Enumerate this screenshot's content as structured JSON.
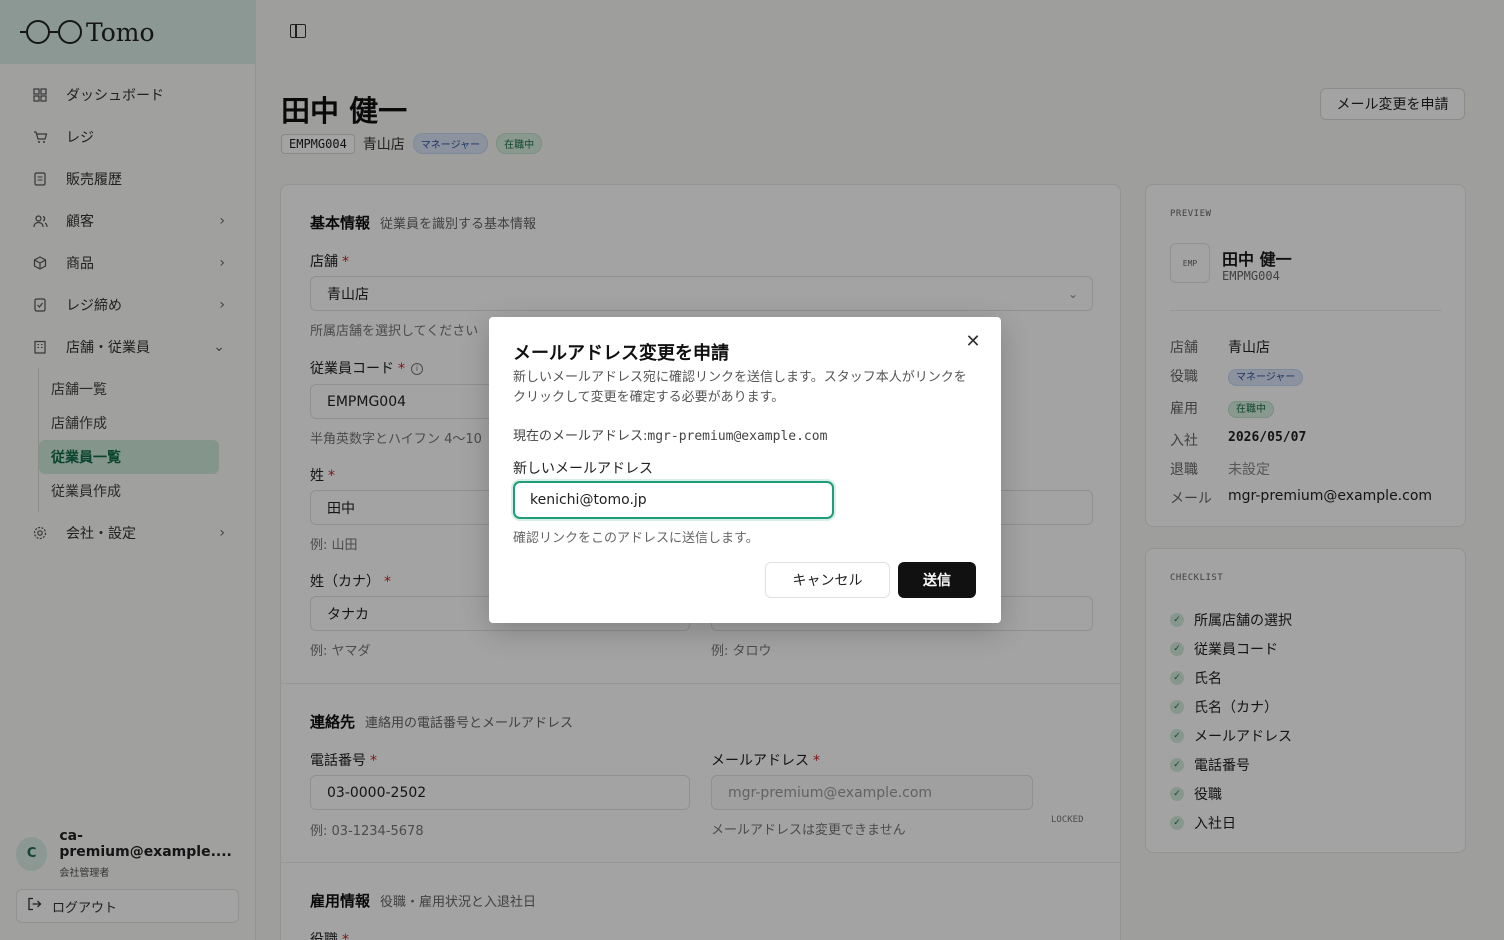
{
  "app": {
    "logo_text": "Tomo"
  },
  "sidebar": {
    "items": [
      {
        "label": "ダッシュボード",
        "icon": "grid-icon"
      },
      {
        "label": "レジ",
        "icon": "cart-icon"
      },
      {
        "label": "販売履歴",
        "icon": "receipt-icon"
      },
      {
        "label": "顧客",
        "icon": "users-icon"
      },
      {
        "label": "商品",
        "icon": "box-icon"
      },
      {
        "label": "レジ締め",
        "icon": "register-icon"
      },
      {
        "label": "店舗・従業員",
        "icon": "building-icon"
      },
      {
        "label": "会社・設定",
        "icon": "gear-icon"
      }
    ],
    "sub_items": [
      "店舗一覧",
      "店舗作成",
      "従業員一覧",
      "従業員作成"
    ],
    "user": {
      "initial": "C",
      "email": "ca-premium@example....",
      "role": "会社管理者"
    },
    "logout": "ログアウト"
  },
  "header": {
    "title": "田中 健一",
    "code": "EMPMG004",
    "store": "青山店",
    "role_badge": "マネージャー",
    "status_badge": "在職中",
    "request_button": "メール変更を申請"
  },
  "form": {
    "basic": {
      "title": "基本情報",
      "desc": "従業員を識別する基本情報",
      "store_label": "店舗",
      "store_value": "青山店",
      "store_hint": "所属店舗を選択してください",
      "code_label": "従業員コード",
      "code_value": "EMPMG004",
      "code_hint": "半角英数字とハイフン 4〜10",
      "last_label": "姓",
      "last_value": "田中",
      "last_hint": "例: 山田",
      "kana_label": "姓（カナ）",
      "kana_value": "タナカ",
      "kana_hint": "例: ヤマダ",
      "first_kana_hint": "例: タロウ"
    },
    "contact": {
      "title": "連絡先",
      "desc": "連絡用の電話番号とメールアドレス",
      "phone_label": "電話番号",
      "phone_value": "03-0000-2502",
      "phone_hint": "例: 03-1234-5678",
      "email_label": "メールアドレス",
      "email_value": "mgr-premium@example.com",
      "email_hint": "メールアドレスは変更できません",
      "locked": "LOCKED"
    },
    "employment": {
      "title": "雇用情報",
      "desc": "役職・雇用状況と入退社日",
      "role_label": "役職"
    }
  },
  "preview": {
    "caption": "PREVIEW",
    "emp_tag": "EMP",
    "name": "田中 健一",
    "code": "EMPMG004",
    "rows": {
      "store_k": "店舗",
      "store_v": "青山店",
      "role_k": "役職",
      "role_v": "マネージャー",
      "employ_k": "雇用",
      "employ_v": "在職中",
      "join_k": "入社",
      "join_v": "2026/05/07",
      "leave_k": "退職",
      "leave_v": "未設定",
      "mail_k": "メール",
      "mail_v": "mgr-premium@example.com"
    }
  },
  "checklist": {
    "caption": "CHECKLIST",
    "items": [
      "所属店舗の選択",
      "従業員コード",
      "氏名",
      "氏名（カナ）",
      "メールアドレス",
      "電話番号",
      "役職",
      "入社日"
    ]
  },
  "modal": {
    "title": "メールアドレス変更を申請",
    "description": "新しいメールアドレス宛に確認リンクを送信します。スタッフ本人がリンクをクリックして変更を確定する必要があります。",
    "current_label": "現在のメールアドレス:",
    "current_value": "mgr-premium@example.com",
    "new_label": "新しいメールアドレス",
    "new_value": "kenichi@tomo.jp",
    "hint": "確認リンクをこのアドレスに送信します。",
    "cancel": "キャンセル",
    "submit": "送信"
  },
  "colors": {
    "accent": "#1f9c7a",
    "sidebar_active": "#cfe9dc",
    "logo_bg": "#dbeee6"
  }
}
